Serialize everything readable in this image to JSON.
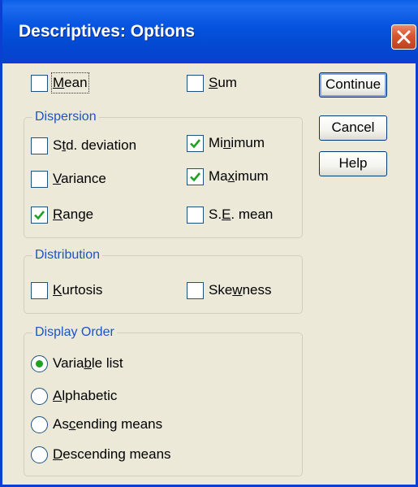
{
  "window": {
    "title": "Descriptives: Options"
  },
  "buttons": {
    "continue": "Continue",
    "cancel": "Cancel",
    "help": "Help"
  },
  "top_checkboxes": {
    "mean": {
      "pre": "",
      "key": "M",
      "post": "ean",
      "checked": false
    },
    "sum": {
      "pre": "",
      "key": "S",
      "post": "um",
      "checked": false
    }
  },
  "dispersion": {
    "legend": "Dispersion",
    "std_deviation": {
      "pre": "S",
      "key": "t",
      "post": "d. deviation",
      "checked": false
    },
    "minimum": {
      "pre": "Mi",
      "key": "n",
      "post": "imum",
      "checked": true
    },
    "variance": {
      "pre": "",
      "key": "V",
      "post": "ariance",
      "checked": false
    },
    "maximum": {
      "pre": "Ma",
      "key": "x",
      "post": "imum",
      "checked": true
    },
    "range": {
      "pre": "",
      "key": "R",
      "post": "ange",
      "checked": true
    },
    "se_mean": {
      "pre": "S.",
      "key": "E",
      "post": ". mean",
      "checked": false
    }
  },
  "distribution": {
    "legend": "Distribution",
    "kurtosis": {
      "pre": "",
      "key": "K",
      "post": "urtosis",
      "checked": false
    },
    "skewness": {
      "pre": "Ske",
      "key": "w",
      "post": "ness",
      "checked": false
    }
  },
  "display_order": {
    "legend": "Display Order",
    "variable_list": {
      "pre": "Varia",
      "key": "b",
      "post": "le list",
      "selected": true
    },
    "alphabetic": {
      "pre": "",
      "key": "A",
      "post": "lphabetic",
      "selected": false
    },
    "ascending_means": {
      "pre": "As",
      "key": "c",
      "post": "ending means",
      "selected": false
    },
    "descending_means": {
      "pre": "",
      "key": "D",
      "post": "escending means",
      "selected": false
    }
  },
  "colors": {
    "titlebar": "#0a3fd1",
    "group_legend": "#1c54c4",
    "checkmark": "#21a121",
    "close_button": "#d9542f"
  }
}
